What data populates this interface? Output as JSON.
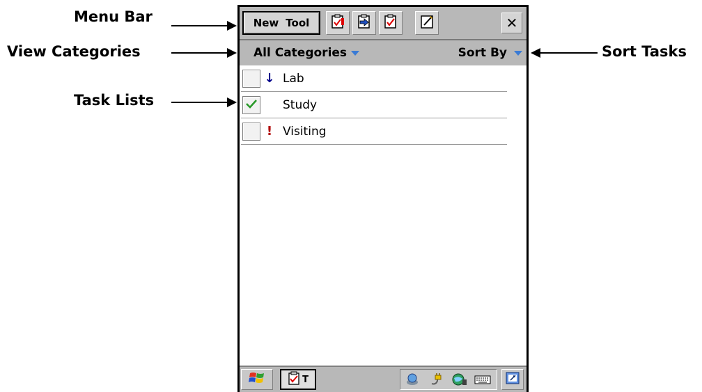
{
  "annotations": {
    "menu_bar": "Menu Bar",
    "view_categories": "View Categories",
    "task_lists": "Task Lists",
    "sort_tasks": "Sort Tasks"
  },
  "toolbar": {
    "new_label": "New",
    "tool_label": "Tool",
    "close_glyph": "✕"
  },
  "filterbar": {
    "categories_label": "All Categories",
    "sort_label": "Sort By"
  },
  "tasks": [
    {
      "label": "Lab",
      "checked": false,
      "priority_glyph": "↓",
      "priority_color": "#00008b"
    },
    {
      "label": "Study",
      "checked": true,
      "priority_glyph": "",
      "priority_color": "#000000"
    },
    {
      "label": "Visiting",
      "checked": false,
      "priority_glyph": "!",
      "priority_color": "#b00000"
    }
  ],
  "taskbar": {
    "app_label": "T"
  },
  "colors": {
    "bar_gray": "#b8b8b8",
    "dropdown_arrow": "#3a7bd5",
    "check_green": "#2a9a2a"
  },
  "icons": {
    "toolbar": [
      "task-edit-icon",
      "beam-icon",
      "complete-task-icon",
      "note-icon"
    ],
    "taskbar_tray": [
      "connectivity-icon",
      "power-plug-icon",
      "network-icon",
      "keyboard-icon"
    ]
  }
}
